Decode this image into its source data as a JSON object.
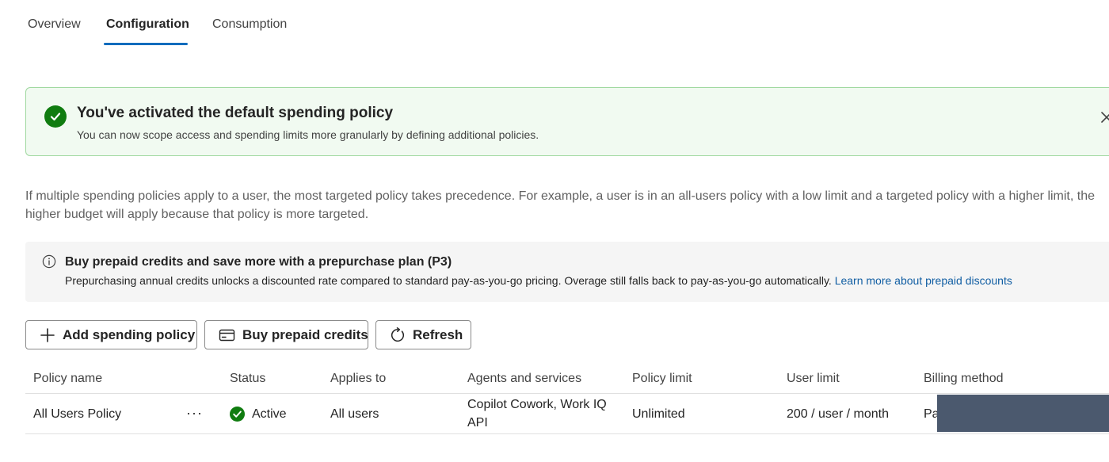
{
  "tabs": [
    {
      "label": "Overview",
      "active": false
    },
    {
      "label": "Configuration",
      "active": true
    },
    {
      "label": "Consumption",
      "active": false
    }
  ],
  "banner": {
    "title": "You've activated the default spending policy",
    "subtitle": "You can now scope access and spending limits more granularly by defining additional policies.",
    "icon": "success-check-icon",
    "color": "#107c10",
    "background": "#f1faf1"
  },
  "description": "If multiple spending policies apply to a user, the most targeted policy takes precedence. For example, a user is in an all-users policy with a low limit and a targeted policy with a higher limit, the higher budget will apply because that policy is more targeted.",
  "info": {
    "icon": "info-icon",
    "title": "Buy prepaid credits and save more with a prepurchase plan (P3)",
    "body": "Prepurchasing annual credits unlocks a discounted rate compared to standard pay-as-you-go pricing. Overage still falls back to pay-as-you-go automatically.",
    "link": "Learn more about prepaid discounts"
  },
  "toolbar": {
    "add_label": "Add spending policy",
    "buy_label": "Buy prepaid credits",
    "refresh_label": "Refresh"
  },
  "table": {
    "columns": [
      "Policy name",
      "Status",
      "Applies to",
      "Agents and services",
      "Policy limit",
      "User limit",
      "Billing method"
    ],
    "rows": [
      {
        "policy_name": "All Users Policy",
        "more": "···",
        "status": "Active",
        "applies_to": "All users",
        "agents_line1": "Copilot Cowork, Work IQ",
        "agents_line2": "API",
        "policy_limit": "Unlimited",
        "user_limit": "200 / user / month",
        "billing_method": "Pa"
      }
    ]
  },
  "colors": {
    "accent": "#0f6cbd",
    "success": "#107c10",
    "link": "#115ea3"
  }
}
